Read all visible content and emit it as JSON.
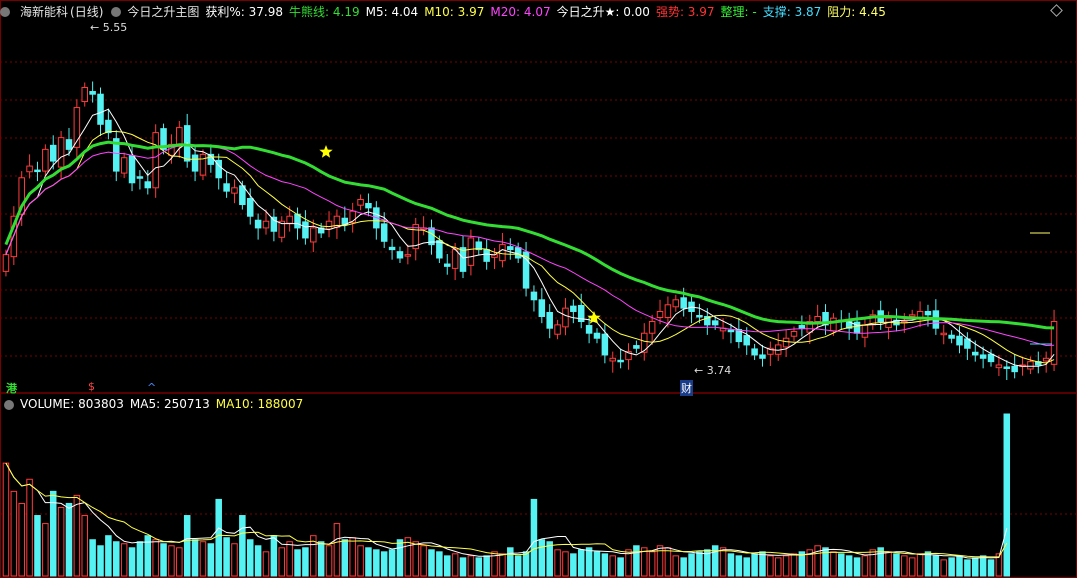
{
  "header": {
    "stock_name": "海新能科",
    "period": "(日线)",
    "indicator_name": "今日之升主图",
    "items": [
      {
        "label": "获利%: 37.98",
        "color": "#ffffff"
      },
      {
        "label": "牛熊线: 4.19",
        "color": "#33dd33"
      },
      {
        "label": "M5: 4.04",
        "color": "#ffffff"
      },
      {
        "label": "M10: 3.97",
        "color": "#ffff44"
      },
      {
        "label": "M20: 4.07",
        "color": "#ff44ff"
      },
      {
        "label": "今日之升★: 0.00",
        "color": "#ffffff"
      },
      {
        "label": "强势: 3.97",
        "color": "#ff3333"
      },
      {
        "label": "整理: -",
        "color": "#33ee33"
      },
      {
        "label": "支撑: 3.87",
        "color": "#44ddff"
      },
      {
        "label": "阻力: 4.45",
        "color": "#ffff66"
      }
    ]
  },
  "annotations": {
    "high_label": "5.55",
    "low_label": "3.74",
    "mark_hk": "港",
    "mark_dollar": "$",
    "mark_caret": "^",
    "mark_finance": "财"
  },
  "volume_header": {
    "items": [
      {
        "label": "VOLUME: 803803",
        "color": "#ffffff"
      },
      {
        "label": "MA5: 250713",
        "color": "#ffffff"
      },
      {
        "label": "MA10: 188007",
        "color": "#ffff44"
      }
    ]
  },
  "colors": {
    "up": "#ff3c3c",
    "down": "#54f2f2",
    "grid": "#7a0000",
    "ma5": "#ffffff",
    "ma10": "#ffff44",
    "ma20": "#ff44ff",
    "bull_bear": "#33dd33",
    "star": "#ffff00"
  },
  "chart_data": {
    "type": "candlestick",
    "ylim": [
      3.6,
      5.7
    ],
    "volume_max": 803803,
    "closes": [
      4.32,
      4.55,
      4.78,
      4.85,
      4.82,
      4.95,
      4.88,
      5.02,
      4.95,
      5.2,
      5.32,
      5.28,
      5.1,
      5.05,
      4.82,
      4.9,
      4.75,
      4.78,
      4.72,
      5.05,
      4.95,
      4.98,
      5.08,
      4.88,
      4.82,
      4.92,
      4.86,
      4.78,
      4.7,
      4.72,
      4.62,
      4.55,
      4.48,
      4.52,
      4.46,
      4.52,
      4.55,
      4.48,
      4.42,
      4.48,
      4.45,
      4.52,
      4.55,
      4.5,
      4.58,
      4.65,
      4.6,
      4.48,
      4.4,
      4.35,
      4.3,
      4.32,
      4.5,
      4.48,
      4.38,
      4.3,
      4.25,
      4.35,
      4.22,
      4.42,
      4.35,
      4.28,
      4.32,
      4.38,
      4.35,
      4.3,
      4.12,
      4.05,
      3.95,
      3.88,
      3.9,
      4.0,
      3.98,
      3.92,
      3.85,
      3.82,
      3.72,
      3.7,
      3.68,
      3.74,
      3.76,
      3.85,
      3.92,
      3.98,
      4.02,
      4.05,
      4.0,
      3.98,
      3.95,
      3.9,
      3.9,
      3.88,
      3.86,
      3.8,
      3.78,
      3.72,
      3.7,
      3.76,
      3.78,
      3.82,
      3.86,
      3.88,
      3.92,
      3.95,
      3.9,
      3.94,
      3.92,
      3.88,
      3.85,
      3.9,
      3.96,
      3.92,
      3.94,
      3.9,
      3.92,
      3.96,
      3.98,
      3.96,
      3.88,
      3.85,
      3.82,
      3.78,
      3.76,
      3.72,
      3.7,
      3.68,
      3.66,
      3.64,
      3.62,
      3.66,
      3.68,
      3.66,
      3.7,
      3.92
    ],
    "volumes": [
      560000,
      420000,
      360000,
      480000,
      300000,
      260000,
      420000,
      340000,
      360000,
      400000,
      300000,
      180000,
      150000,
      200000,
      170000,
      160000,
      140000,
      170000,
      200000,
      180000,
      160000,
      150000,
      140000,
      300000,
      180000,
      170000,
      160000,
      380000,
      190000,
      160000,
      300000,
      180000,
      150000,
      120000,
      200000,
      140000,
      170000,
      130000,
      140000,
      200000,
      170000,
      150000,
      260000,
      180000,
      190000,
      150000,
      140000,
      130000,
      120000,
      130000,
      180000,
      190000,
      170000,
      150000,
      130000,
      120000,
      100000,
      110000,
      90000,
      100000,
      90000,
      100000,
      120000,
      110000,
      140000,
      100000,
      120000,
      380000,
      180000,
      170000,
      130000,
      120000,
      110000,
      130000,
      140000,
      120000,
      110000,
      100000,
      90000,
      130000,
      150000,
      140000,
      120000,
      150000,
      140000,
      100000,
      90000,
      110000,
      120000,
      130000,
      150000,
      140000,
      110000,
      100000,
      90000,
      110000,
      120000,
      100000,
      90000,
      100000,
      110000,
      120000,
      130000,
      150000,
      140000,
      120000,
      110000,
      100000,
      90000,
      100000,
      130000,
      140000,
      120000,
      110000,
      100000,
      90000,
      110000,
      120000,
      100000,
      80000,
      90000,
      100000,
      80000,
      90000,
      100000,
      80000,
      110000,
      803803
    ]
  }
}
